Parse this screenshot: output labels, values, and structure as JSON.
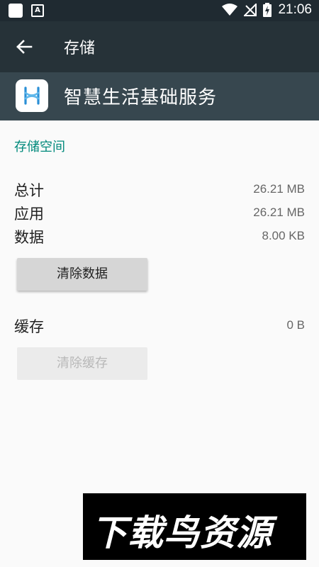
{
  "status_bar": {
    "time": "21:06",
    "notification_icons": [
      "app-square-icon",
      "a-letter-icon"
    ],
    "status_icons": [
      "wifi-icon",
      "no-signal-icon",
      "battery-charging-icon"
    ],
    "a_icon_glyph": "A"
  },
  "toolbar": {
    "title": "存储",
    "back_icon": "back-arrow-icon"
  },
  "app": {
    "name": "智慧生活基础服务",
    "icon": "app-logo-icon"
  },
  "storage": {
    "section_title": "存储空间",
    "rows": [
      {
        "label": "总计",
        "value": "26.21 MB"
      },
      {
        "label": "应用",
        "value": "26.21 MB"
      },
      {
        "label": "数据",
        "value": "8.00 KB"
      }
    ],
    "clear_data_button": "清除数据",
    "cache_label": "缓存",
    "cache_value": "0 B",
    "clear_cache_button": "清除缓存"
  },
  "watermark": {
    "text": "下载鸟资源"
  },
  "colors": {
    "accent": "#00897b",
    "toolbar": "#263238",
    "app_header": "#37474f"
  }
}
